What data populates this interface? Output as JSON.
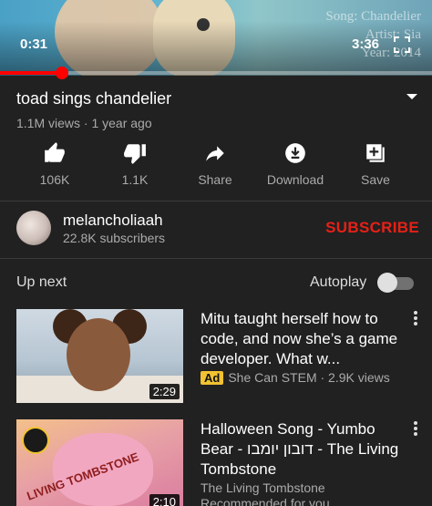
{
  "player": {
    "song_info": [
      "Song: Chandelier",
      "Artist: Sia",
      "Year: 2014"
    ],
    "current_time": "0:31",
    "total_time": "3:36",
    "progress_fraction": 0.144
  },
  "video": {
    "title": "toad sings chandelier",
    "meta": "1.1M views · 1 year ago"
  },
  "actions": [
    {
      "label": "106K",
      "icon": "thumbs-up-icon"
    },
    {
      "label": "1.1K",
      "icon": "thumbs-down-icon"
    },
    {
      "label": "Share",
      "icon": "share-icon"
    },
    {
      "label": "Download",
      "icon": "download-icon"
    },
    {
      "label": "Save",
      "icon": "save-playlist-icon"
    }
  ],
  "channel": {
    "name": "melancholiaah",
    "subscribers": "22.8K subscribers",
    "subscribe_label": "SUBSCRIBE"
  },
  "up_next": {
    "heading": "Up next",
    "autoplay_label": "Autoplay",
    "autoplay_on": false
  },
  "videos": [
    {
      "title": "Mitu taught herself how to code, and now she’s a game developer. What w...",
      "ad_label": "Ad",
      "subtitle": "She Can STEM · 2.9K views",
      "duration": "2:29"
    },
    {
      "title": "Halloween Song - Yumbo Bear - דובון יומבו - The Living Tombstone",
      "subtitle": "The Living Tombstone",
      "subtitle2": "Recommended for you",
      "duration": "2:10",
      "thumb_text": "LIVING TOMBSTONE"
    }
  ],
  "colors": {
    "background": "#212121",
    "accent_red": "#ff0000",
    "subscribe_red": "#e62117",
    "ad_yellow": "#f1c232"
  }
}
